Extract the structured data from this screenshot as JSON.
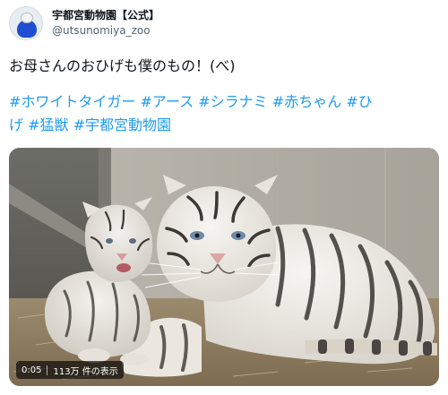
{
  "account": {
    "display_name": "宇都宮動物園【公式】",
    "handle": "@utsunomiya_zoo",
    "avatar_icon": "mascot-avatar-icon"
  },
  "tweet": {
    "text": "お母さんのおひげも僕のもの！(べ)",
    "hashtags_line1": [
      "#ホワイトタイガー",
      "#アース",
      "#シラナミ",
      "#赤ちゃん",
      "#ひ"
    ],
    "hashtags_line2": [
      "げ",
      "#猛獣",
      "#宇都宮動物園"
    ],
    "link_color": "#1d9bf0"
  },
  "video": {
    "elapsed": "0:05",
    "views": "113万 件の表示",
    "subject": "white tiger mother and cub"
  }
}
